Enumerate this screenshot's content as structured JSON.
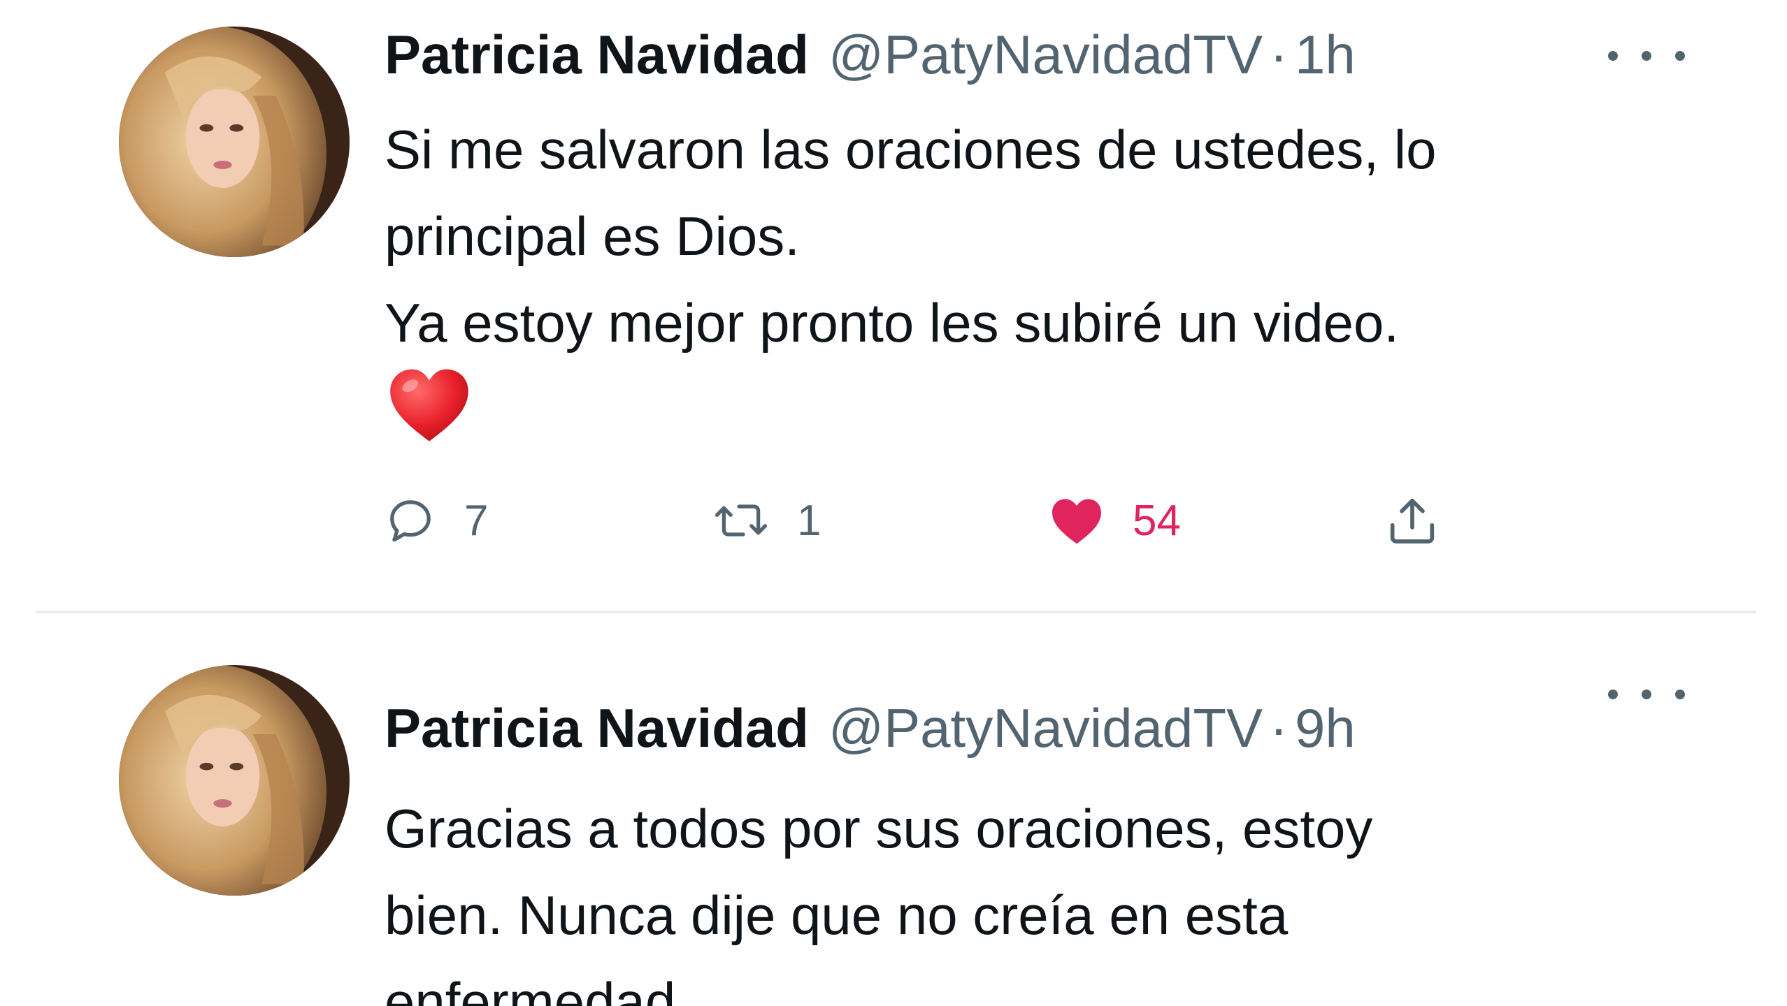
{
  "tweets": [
    {
      "author_name": "Patricia Navidad",
      "handle": "@PatyNavidadTV",
      "separator": "·",
      "time": "1h",
      "text_lines": [
        "Si me salvaron las oraciones de ustedes, lo",
        "principal es Dios.",
        "Ya estoy mejor pronto les subiré un video."
      ],
      "emoji": "red-heart",
      "actions": {
        "reply_count": "7",
        "retweet_count": "1",
        "like_count": "54",
        "liked": true
      }
    },
    {
      "author_name": "Patricia Navidad",
      "handle": "@PatyNavidadTV",
      "separator": "·",
      "time": "9h",
      "text_lines": [
        "Gracias a todos por sus oraciones, estoy",
        "bien. Nunca dije que no creía en esta",
        "enfermedad."
      ]
    }
  ],
  "colors": {
    "text_primary": "#0f1419",
    "text_secondary": "#536471",
    "like_active": "#e0245e",
    "divider": "#e6ecf0"
  },
  "icons": {
    "reply": "reply-icon",
    "retweet": "retweet-icon",
    "like": "heart-icon",
    "share": "share-icon",
    "more": "more-options-icon"
  }
}
